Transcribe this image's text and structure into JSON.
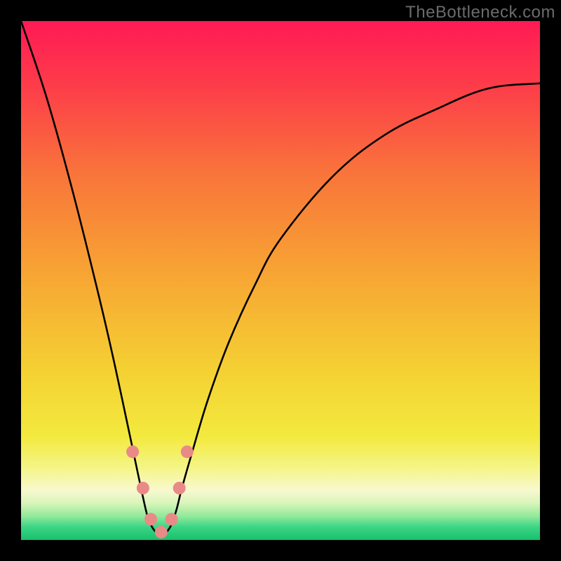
{
  "watermark": "TheBottleneck.com",
  "chart_data": {
    "type": "line",
    "title": "",
    "xlabel": "",
    "ylabel": "",
    "xlim": [
      0,
      100
    ],
    "ylim": [
      0,
      100
    ],
    "optimum_x": 27,
    "series": [
      {
        "name": "bottleneck-curve",
        "x": [
          0,
          5,
          10,
          15,
          18,
          21,
          24,
          25,
          26,
          27,
          28,
          29,
          30,
          31,
          33,
          36,
          40,
          45,
          50,
          60,
          70,
          80,
          90,
          100
        ],
        "values": [
          100,
          85,
          67,
          47,
          34,
          20,
          6,
          3,
          1.5,
          1,
          1.5,
          3,
          6,
          10,
          17,
          27,
          38,
          49,
          58,
          70,
          78,
          83,
          87,
          88
        ]
      }
    ],
    "highlight_points": {
      "name": "near-optimum-dots",
      "color": "#e98a87",
      "x": [
        21.5,
        23.5,
        25.0,
        27.0,
        29.0,
        30.5,
        32.0
      ],
      "values": [
        17.0,
        10.0,
        4.0,
        1.5,
        4.0,
        10.0,
        17.0
      ]
    },
    "gradient_stops": [
      {
        "offset": 0.0,
        "color": "#ff1a55"
      },
      {
        "offset": 0.12,
        "color": "#fd3b4a"
      },
      {
        "offset": 0.3,
        "color": "#f9763a"
      },
      {
        "offset": 0.5,
        "color": "#f7a833"
      },
      {
        "offset": 0.68,
        "color": "#f4d233"
      },
      {
        "offset": 0.8,
        "color": "#f3e93e"
      },
      {
        "offset": 0.86,
        "color": "#f5f586"
      },
      {
        "offset": 0.905,
        "color": "#f8f8d0"
      },
      {
        "offset": 0.93,
        "color": "#d6f5b8"
      },
      {
        "offset": 0.955,
        "color": "#8fe89a"
      },
      {
        "offset": 0.975,
        "color": "#3bd586"
      },
      {
        "offset": 1.0,
        "color": "#17c06b"
      }
    ]
  }
}
